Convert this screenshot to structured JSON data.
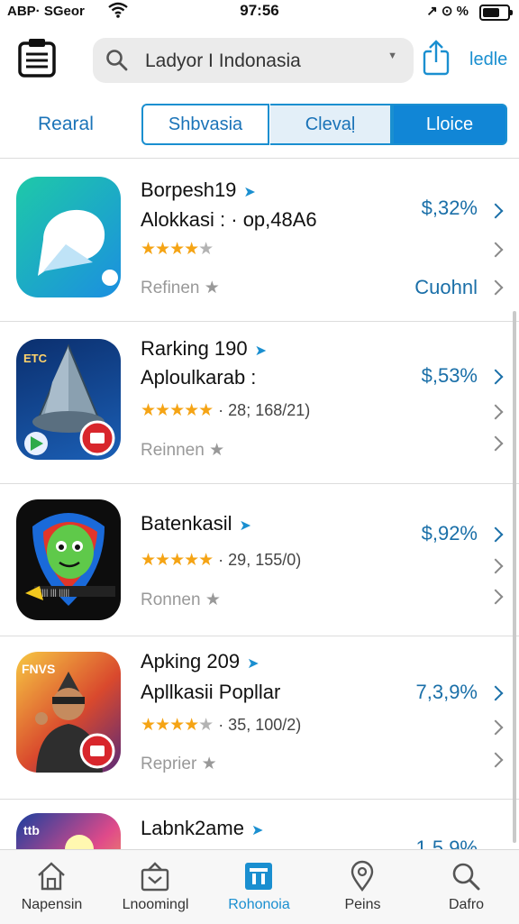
{
  "status_bar": {
    "carrier": "ABP· SGeor",
    "time": "97:56",
    "right": "↗ ⊙ %"
  },
  "header": {
    "search_text": "Ladyor I Indonasia",
    "search_caret": "▼",
    "edit_label": "ledle"
  },
  "tabs": {
    "first": "Rearal",
    "segments": [
      "Shbvasia",
      "Clevaḷ",
      "Lloice"
    ]
  },
  "colors": {
    "accent": "#1a8fd0",
    "star": "#f5a415"
  },
  "apps": [
    {
      "line1": "Borpesh19",
      "line2": "Alokkasi : · op,48A6",
      "reviews": "",
      "price": "$,32%",
      "sub": "Refinen",
      "extra": "Cuohnl",
      "icon": "teal-chat-app-icon"
    },
    {
      "line1": "Rarking 190",
      "line2": "Aploulkarab :",
      "reviews": "· 28; 168/21)",
      "price": "$,53%",
      "sub": "Reinnen",
      "extra": "",
      "icon": "rocket-game-icon"
    },
    {
      "line1": "Batenkasil",
      "line2": "",
      "reviews": "· 29, 155/0)",
      "price": "$,92%",
      "sub": "Ronnen",
      "extra": "",
      "icon": "alien-shield-icon"
    },
    {
      "line1": "Apking 209",
      "line2": "Apllkasii Popllar",
      "reviews": "· 35, 100/2)",
      "price": "7,3,9%",
      "sub": "Reprier",
      "extra": "",
      "icon": "hero-game-icon"
    },
    {
      "line1": "Labnk2ame",
      "line2": "",
      "reviews": "",
      "price": "1.5,9%",
      "sub": "",
      "extra": "",
      "icon": "colorful-game-icon"
    }
  ],
  "bottom_nav": [
    "Napensin",
    "Lnoomingl",
    "Rohonoia",
    "Peins",
    "Dafro"
  ]
}
